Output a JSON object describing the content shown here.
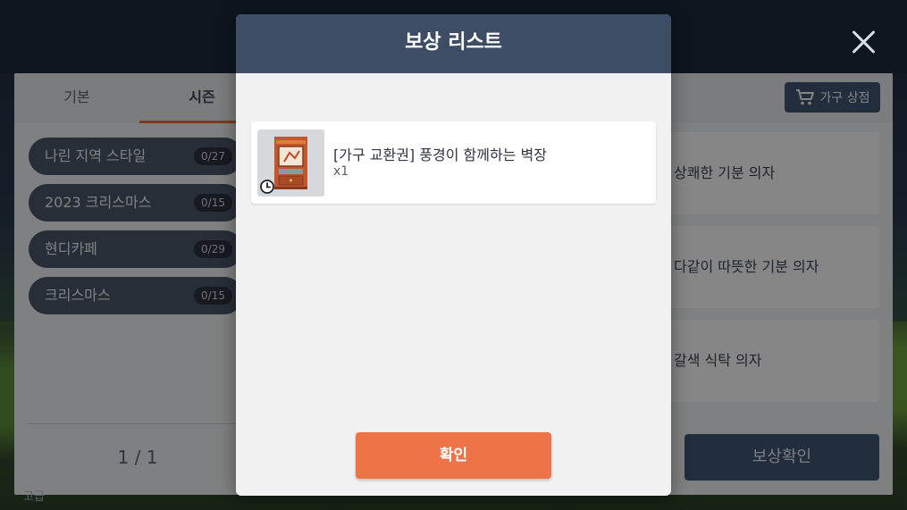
{
  "background": {
    "tabs": [
      {
        "label": "기본",
        "active": false
      },
      {
        "label": "시즌",
        "active": true
      }
    ],
    "shop_button": {
      "label": "가구 상점",
      "icon": "cart-icon"
    },
    "categories": [
      {
        "label": "나린 지역 스타일",
        "count": "0/27"
      },
      {
        "label": "2023 크리스마스",
        "count": "0/15"
      },
      {
        "label": "현디카페",
        "count": "0/29"
      },
      {
        "label": "크리스마스",
        "count": "0/15"
      }
    ],
    "pagination": "1 / 1",
    "items": [
      {
        "name": "상쾌한 기분 의자"
      },
      {
        "name": "다같이 따뜻한 기분 의자"
      },
      {
        "name": "갈색 식탁 의자"
      }
    ],
    "reward_confirm_label": "보상확인",
    "bottom_hint": "고급"
  },
  "modal": {
    "title": "보상 리스트",
    "rewards": [
      {
        "name": "[가구 교환권] 풍경이 함께하는 벽장",
        "quantity": "x1",
        "icon": "cabinet-icon",
        "badge_icon": "clock-icon"
      }
    ],
    "confirm_label": "확인"
  },
  "colors": {
    "modal_header": "#3d4d66",
    "confirm_button": "#ec7448",
    "tab_active_underline": "#e0703f",
    "shop_button": "#3f5470"
  }
}
